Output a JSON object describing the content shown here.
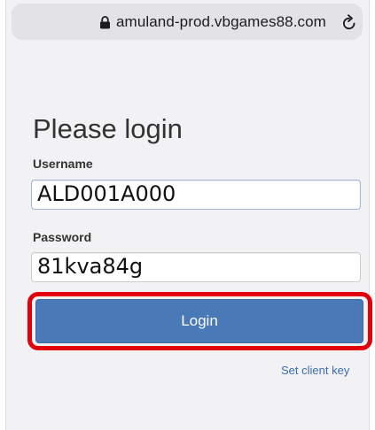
{
  "browser": {
    "url": "amuland-prod.vbgames88.com",
    "icons": {
      "lock": "lock-icon",
      "reload": "reload-icon"
    }
  },
  "login": {
    "title": "Please login",
    "username_label": "Username",
    "username_value": "ALD001A000",
    "password_label": "Password",
    "password_value": "81kva84g",
    "login_button": "Login",
    "client_key_link": "Set client key"
  },
  "colors": {
    "button": "#4a79b8",
    "highlight": "#e2000b",
    "link": "#3a6db0"
  }
}
